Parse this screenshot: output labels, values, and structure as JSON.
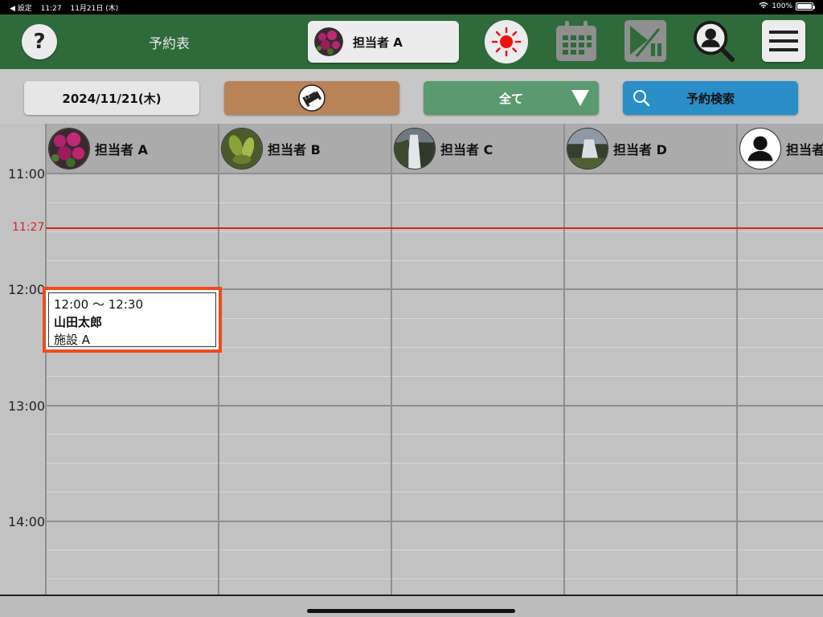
{
  "status_bar": {
    "back_label": "◀ 設定",
    "time": "11:27",
    "date": "11月21日 (木)",
    "battery": "100%"
  },
  "header": {
    "help_label": "?",
    "title": "予約表",
    "current_staff": "担当者 A",
    "icons": [
      "sun-icon",
      "calendar-icon",
      "play-pause-icon",
      "user-search-icon",
      "hamburger-menu-icon"
    ]
  },
  "toolbar": {
    "date": "2024/11/21(木)",
    "bed_icon": "bed-icon",
    "filter": "全て",
    "search": "予約検索"
  },
  "schedule": {
    "staff": [
      {
        "name": "担当者 A",
        "avatar": "flowers"
      },
      {
        "name": "担当者 B",
        "avatar": "leaves"
      },
      {
        "name": "担当者 C",
        "avatar": "waterfall"
      },
      {
        "name": "担当者 D",
        "avatar": "waterfall2"
      },
      {
        "name": "担当者",
        "avatar": "person"
      }
    ],
    "hours": [
      "11:00",
      "12:00",
      "13:00",
      "14:00"
    ],
    "now_label": "11:27",
    "appointment": {
      "time": "12:00 ～ 12:30",
      "name": "山田太郎",
      "facility": "施設 A"
    }
  },
  "colors": {
    "header": "#2f6b3a",
    "now_line": "#dd2222",
    "appt_border": "#f04a1c",
    "filter_btn": "#5a9a6e",
    "search_btn": "#2a8ec9",
    "bed_btn": "#b98358"
  }
}
